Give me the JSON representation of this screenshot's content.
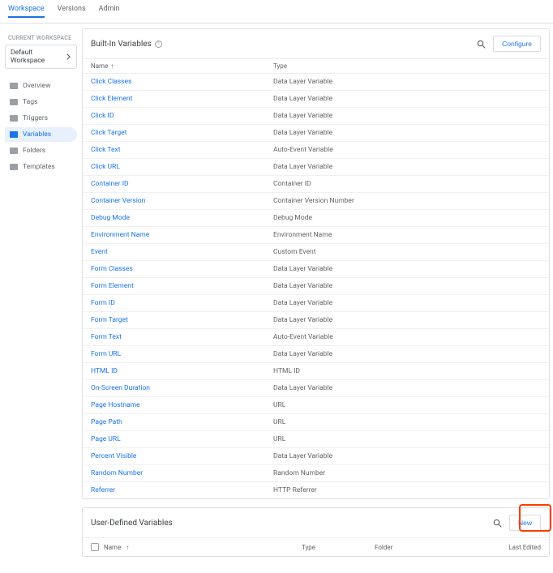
{
  "topnav": {
    "tabs": [
      "Workspace",
      "Versions",
      "Admin"
    ],
    "active": 0
  },
  "sidebar": {
    "current_workspace_label": "CURRENT WORKSPACE",
    "workspace_name": "Default Workspace",
    "items": [
      {
        "label": "Overview"
      },
      {
        "label": "Tags"
      },
      {
        "label": "Triggers"
      },
      {
        "label": "Variables"
      },
      {
        "label": "Folders"
      },
      {
        "label": "Templates"
      }
    ],
    "active": 3
  },
  "builtin": {
    "title": "Built-In Variables",
    "configure_label": "Configure",
    "columns": {
      "name": "Name",
      "type": "Type"
    },
    "rows": [
      {
        "name": "Click Classes",
        "type": "Data Layer Variable"
      },
      {
        "name": "Click Element",
        "type": "Data Layer Variable"
      },
      {
        "name": "Click ID",
        "type": "Data Layer Variable"
      },
      {
        "name": "Click Target",
        "type": "Data Layer Variable"
      },
      {
        "name": "Click Text",
        "type": "Auto-Event Variable"
      },
      {
        "name": "Click URL",
        "type": "Data Layer Variable"
      },
      {
        "name": "Container ID",
        "type": "Container ID"
      },
      {
        "name": "Container Version",
        "type": "Container Version Number"
      },
      {
        "name": "Debug Mode",
        "type": "Debug Mode"
      },
      {
        "name": "Environment Name",
        "type": "Environment Name"
      },
      {
        "name": "Event",
        "type": "Custom Event"
      },
      {
        "name": "Form Classes",
        "type": "Data Layer Variable"
      },
      {
        "name": "Form Element",
        "type": "Data Layer Variable"
      },
      {
        "name": "Form ID",
        "type": "Data Layer Variable"
      },
      {
        "name": "Form Target",
        "type": "Data Layer Variable"
      },
      {
        "name": "Form Text",
        "type": "Auto-Event Variable"
      },
      {
        "name": "Form URL",
        "type": "Data Layer Variable"
      },
      {
        "name": "HTML ID",
        "type": "HTML ID"
      },
      {
        "name": "On-Screen Duration",
        "type": "Data Layer Variable"
      },
      {
        "name": "Page Hostname",
        "type": "URL"
      },
      {
        "name": "Page Path",
        "type": "URL"
      },
      {
        "name": "Page URL",
        "type": "URL"
      },
      {
        "name": "Percent Visible",
        "type": "Data Layer Variable"
      },
      {
        "name": "Random Number",
        "type": "Random Number"
      },
      {
        "name": "Referrer",
        "type": "HTTP Referrer"
      }
    ]
  },
  "udv": {
    "title": "User-Defined Variables",
    "new_label": "New",
    "columns": {
      "name": "Name",
      "type": "Type",
      "folder": "Folder",
      "last_edited": "Last Edited"
    }
  }
}
